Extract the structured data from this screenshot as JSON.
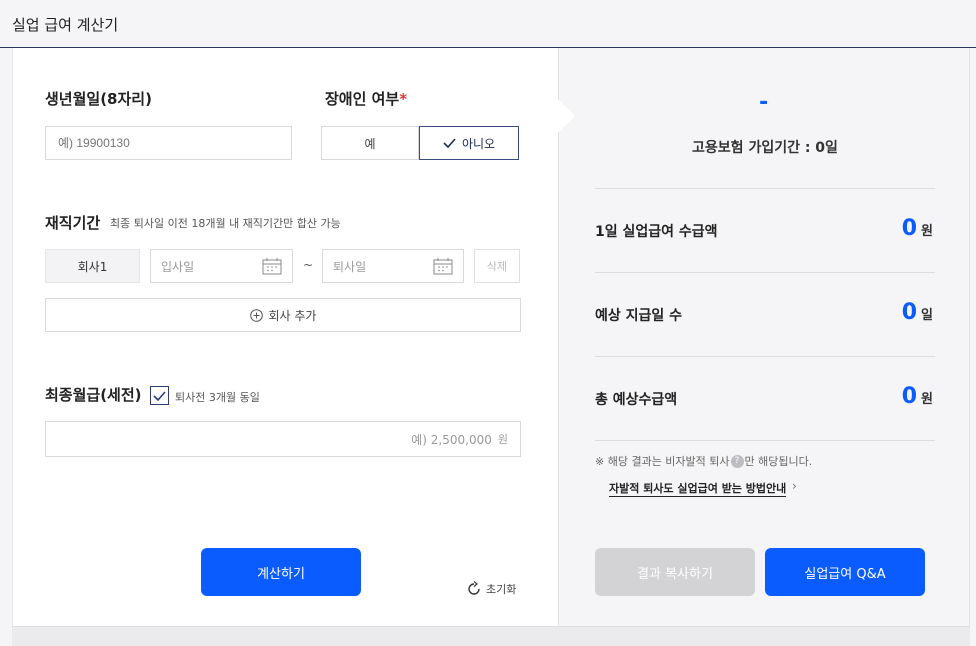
{
  "header": {
    "title": "실업 급여 계산기"
  },
  "form": {
    "birth": {
      "label": "생년월일(8자리)",
      "placeholder": "예) 19900130"
    },
    "disability": {
      "label": "장애인 여부",
      "required_mark": "*",
      "options": [
        "예",
        "아니오"
      ],
      "selected": "아니오"
    },
    "tenure": {
      "label": "재직기간",
      "hint": "최종 퇴사일 이전 18개월 내 재직기간만 합산 가능",
      "companies": [
        {
          "name": "회사1",
          "start_placeholder": "입사일",
          "end_placeholder": "퇴사일",
          "separator": "~",
          "delete_label": "삭제"
        }
      ],
      "add_label": "회사 추가"
    },
    "wage": {
      "label": "최종월급(세전)",
      "same_label": "퇴사전 3개월 동일",
      "same_checked": true,
      "placeholder": "예) 2,500,000",
      "unit": "원"
    },
    "calc_button": "계산하기",
    "reset_label": "초기화"
  },
  "result": {
    "dash": "-",
    "period_text": "고용보험 가입기간 : 0일",
    "rows": [
      {
        "label": "1일 실업급여 수급액",
        "value": "0",
        "unit": "원"
      },
      {
        "label": "예상 지급일 수",
        "value": "0",
        "unit": "일"
      },
      {
        "label": "총 예상수급액",
        "value": "0",
        "unit": "원"
      }
    ],
    "note_prefix": "※ 해당 결과는 비자발적 퇴사",
    "note_qmark": "?",
    "note_suffix": "만 해당됩니다.",
    "guide_link": "자발적 퇴사도 실업급여 받는 방법안내",
    "guide_arrow": "›",
    "copy_button": "결과 복사하기",
    "qa_button": "실업급여 Q&A"
  },
  "colors": {
    "accent": "#0a5cff",
    "disabled": "#d3d3d6",
    "navy": "#2c3b78"
  }
}
